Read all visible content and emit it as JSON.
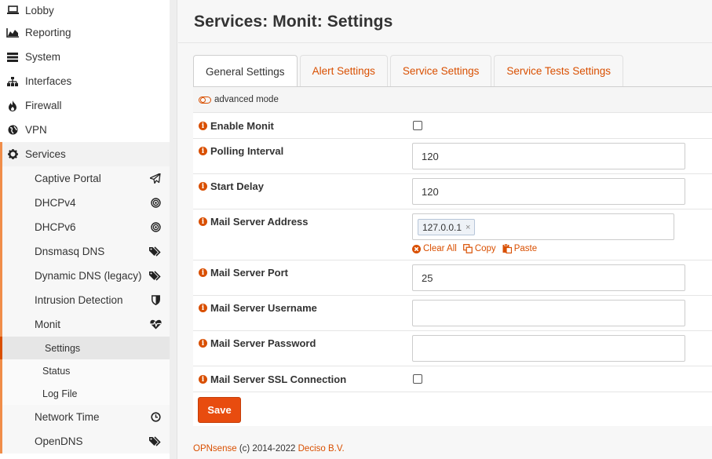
{
  "sidebar": {
    "items": [
      {
        "label": "Lobby",
        "icon": "laptop-icon"
      },
      {
        "label": "Reporting",
        "icon": "area-chart-icon"
      },
      {
        "label": "System",
        "icon": "server-icon"
      },
      {
        "label": "Interfaces",
        "icon": "sitemap-icon"
      },
      {
        "label": "Firewall",
        "icon": "fire-icon"
      },
      {
        "label": "VPN",
        "icon": "globe-icon"
      },
      {
        "label": "Services",
        "icon": "gear-icon"
      }
    ],
    "services": [
      {
        "label": "Captive Portal",
        "icon": "paper-plane-icon"
      },
      {
        "label": "DHCPv4",
        "icon": "bullseye-icon"
      },
      {
        "label": "DHCPv6",
        "icon": "bullseye-icon"
      },
      {
        "label": "Dnsmasq DNS",
        "icon": "tags-icon"
      },
      {
        "label": "Dynamic DNS (legacy)",
        "icon": "tags-icon"
      },
      {
        "label": "Intrusion Detection",
        "icon": "shield-icon"
      },
      {
        "label": "Monit",
        "icon": "heartbeat-icon"
      }
    ],
    "monit_sub": [
      {
        "label": "Settings",
        "active": true
      },
      {
        "label": "Status",
        "active": false
      },
      {
        "label": "Log File",
        "active": false
      }
    ],
    "services_after": [
      {
        "label": "Network Time",
        "icon": "clock-icon"
      },
      {
        "label": "OpenDNS",
        "icon": "tags-icon"
      }
    ]
  },
  "header": {
    "title": "Services: Monit: Settings"
  },
  "tabs": [
    {
      "label": "General Settings",
      "active": true
    },
    {
      "label": "Alert Settings",
      "active": false
    },
    {
      "label": "Service Settings",
      "active": false
    },
    {
      "label": "Service Tests Settings",
      "active": false
    }
  ],
  "form": {
    "advanced_mode": "advanced mode",
    "enable_monit": {
      "label": "Enable Monit",
      "checked": false
    },
    "polling_interval": {
      "label": "Polling Interval",
      "value": "120"
    },
    "start_delay": {
      "label": "Start Delay",
      "value": "120"
    },
    "mail_server_address": {
      "label": "Mail Server Address",
      "tag": "127.0.0.1",
      "clear_all": "Clear All",
      "copy": "Copy",
      "paste": "Paste"
    },
    "mail_server_port": {
      "label": "Mail Server Port",
      "value": "25"
    },
    "mail_server_username": {
      "label": "Mail Server Username",
      "value": ""
    },
    "mail_server_password": {
      "label": "Mail Server Password",
      "value": ""
    },
    "mail_server_ssl": {
      "label": "Mail Server SSL Connection",
      "checked": false
    },
    "save_label": "Save"
  },
  "footer": {
    "brand": "OPNsense",
    "copyright": "(c) 2014-2022",
    "company": "Deciso B.V."
  },
  "colors": {
    "accent": "#d94f00",
    "save_button": "#e84c0f",
    "sidebar_stripe": "#f08d49"
  }
}
